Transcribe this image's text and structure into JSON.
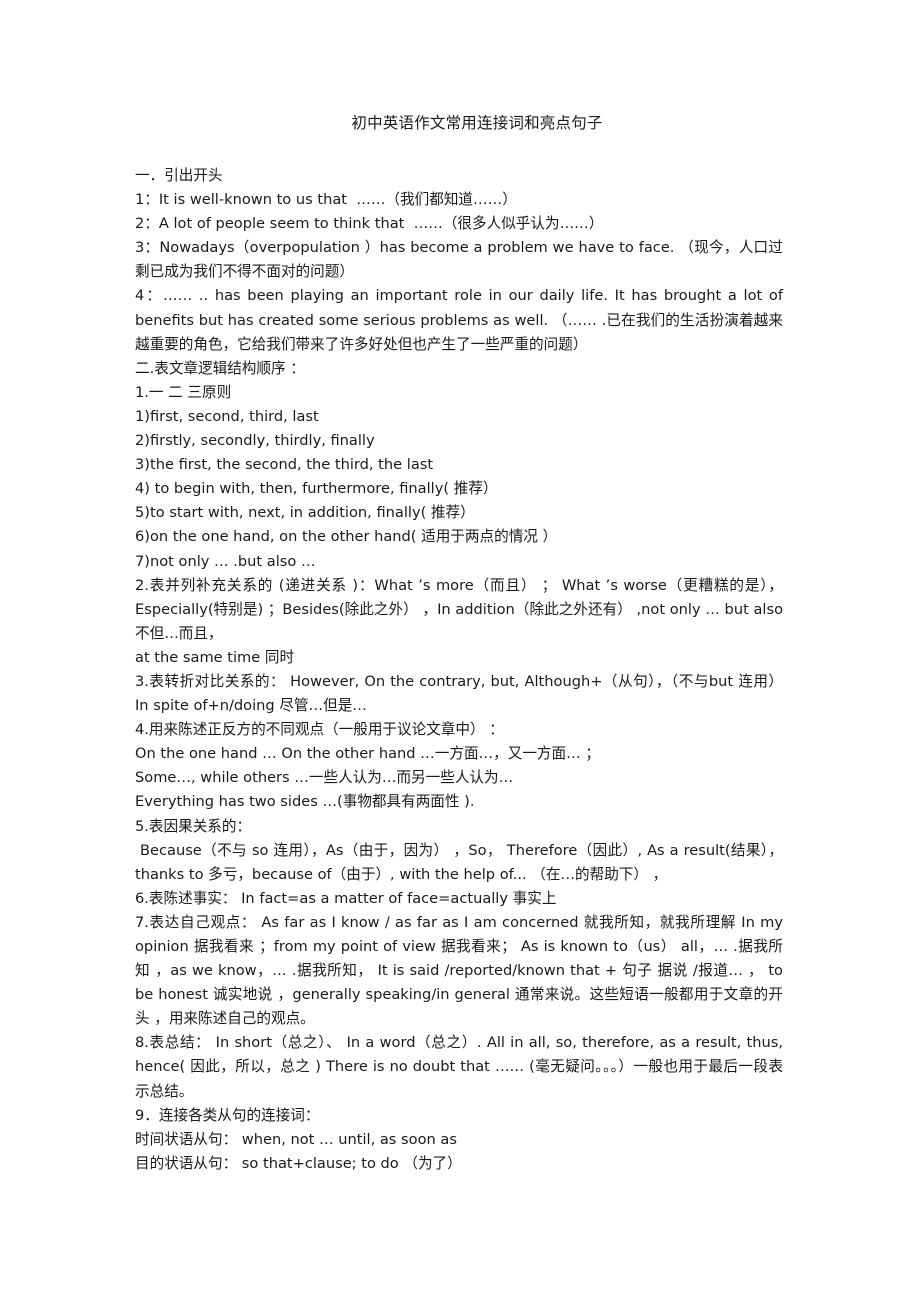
{
  "document": {
    "title": "初中英语作文常用连接词和亮点句子",
    "blocks": [
      {
        "id": "s1-head",
        "kind": "line",
        "text": "一．引出开头"
      },
      {
        "id": "s1-1",
        "kind": "line",
        "text": "1：It is well-known to us that  ……（我们都知道……）"
      },
      {
        "id": "s1-2",
        "kind": "line",
        "text": "2：A lot of people seem to think that  ……（很多人似乎认为……）"
      },
      {
        "id": "s1-3",
        "kind": "para",
        "text": "3：Nowadays（overpopulation ）has become a problem we have to face. （现今，人口过剩已成为我们不得不面对的问题）"
      },
      {
        "id": "s1-4",
        "kind": "para",
        "text": "4：…… .. has been playing an important role in our daily life. It has brought a lot of benefits but has created some serious problems as well. （…… .已在我们的生活扮演着越来越重要的角色，它给我们带来了许多好处但也产生了一些严重的问题）"
      },
      {
        "id": "s2-head",
        "kind": "line",
        "text": "二.表文章逻辑结构顺序 ："
      },
      {
        "id": "s2-1",
        "kind": "line",
        "text": "1.一 二 三原则"
      },
      {
        "id": "s2-1-1",
        "kind": "line",
        "text": "1)first, second, third, last"
      },
      {
        "id": "s2-1-2",
        "kind": "line",
        "text": "2)firstly, secondly, thirdly, finally"
      },
      {
        "id": "s2-1-3",
        "kind": "line",
        "text": "3)the first, the second, the third, the last"
      },
      {
        "id": "s2-1-4",
        "kind": "line",
        "text": "4) to begin with, then, furthermore, finally( 推荐）"
      },
      {
        "id": "s2-1-5",
        "kind": "line",
        "text": "5)to start with, next, in addition, finally( 推荐）"
      },
      {
        "id": "s2-1-6",
        "kind": "line",
        "text": "6)on the one hand, on the other hand( 适用于两点的情况 ）"
      },
      {
        "id": "s2-1-7",
        "kind": "line",
        "text": "7)not only … .but also …"
      },
      {
        "id": "s2-2",
        "kind": "para",
        "text": "2.表并列补充关系的 (递进关系 )：What ’s more（而且） ； What ’s worse（更糟糕的是），Especially(特别是) ；Besides(除此之外） ，In addition（除此之外还有） ,not only … but also 不但…而且，"
      },
      {
        "id": "s2-2b",
        "kind": "line",
        "text": "at the same time 同时"
      },
      {
        "id": "s2-3",
        "kind": "para",
        "text": "3.表转折对比关系的： However, On the contrary, but, Although+（从句），（不与but 连用） In spite of+n/doing 尽管…但是…"
      },
      {
        "id": "s2-4",
        "kind": "line",
        "text": "4.用来陈述正反方的不同观点（一般用于议论文章中） ："
      },
      {
        "id": "s2-4-1",
        "kind": "line",
        "text": "On the one hand … On the other hand …一方面…，又一方面… ；"
      },
      {
        "id": "s2-4-2",
        "kind": "line",
        "text": "Some…, while others …一些人认为…而另一些人认为…"
      },
      {
        "id": "s2-4-3",
        "kind": "line",
        "text": "Everything has two sides …(事物都具有两面性 )."
      },
      {
        "id": "s2-5",
        "kind": "line",
        "text": "5.表因果关系的："
      },
      {
        "id": "s2-5-1",
        "kind": "para",
        "text": " Because（不与 so 连用），As（由于，因为） ，So， Therefore（因此）, As a result(结果），thanks to 多亏，because of（由于）, with the help of... （在…的帮助下） ，"
      },
      {
        "id": "s2-6",
        "kind": "line",
        "text": "6.表陈述事实： In fact=as a matter of face=actually 事实上"
      },
      {
        "id": "s2-7",
        "kind": "para",
        "text": "7.表达自己观点： As far as I know / as far as I am concerned 就我所知，就我所理解 In my opinion 据我看来 ；from my point of view 据我看来； As is known to（us） all，… .据我所知 ，as we know，… .据我所知， It is said /reported/known that + 句子 据说 /报道… ， to be honest 诚实地说 ，generally speaking/in general 通常来说。这些短语一般都用于文章的开头 ，用来陈述自己的观点。"
      },
      {
        "id": "s2-8",
        "kind": "para",
        "text": "8.表总结： In short（总之）、 In a word（总之）. All in all, so, therefore, as a result, thus, hence( 因此，所以，总之 ) There is no doubt that …… (毫无疑问。。。）一般也用于最后一段表示总结。"
      },
      {
        "id": "s2-9",
        "kind": "line",
        "text": "9．连接各类从句的连接词："
      },
      {
        "id": "s2-9-1",
        "kind": "line",
        "text": "时间状语从句： when, not … until, as soon as"
      },
      {
        "id": "s2-9-2",
        "kind": "line",
        "text": "目的状语从句： so that+clause; to do （为了）"
      }
    ]
  }
}
